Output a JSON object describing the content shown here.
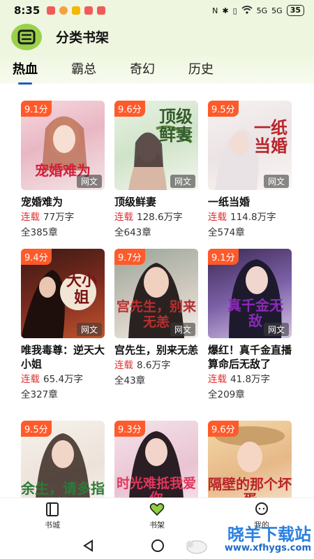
{
  "status_bar": {
    "time": "8:35",
    "signal_label": "5G",
    "battery": "35"
  },
  "header": {
    "title": "分类书架"
  },
  "tabs": [
    {
      "label": "热血",
      "active": true
    },
    {
      "label": "霸总",
      "active": false
    },
    {
      "label": "奇幻",
      "active": false
    },
    {
      "label": "历史",
      "active": false
    }
  ],
  "books": [
    {
      "title": "宠婚难为",
      "score": "9.1分",
      "status": "连载",
      "words": "77万字",
      "chapters": "全385章",
      "badge": "网文",
      "cover_text": "宠婚难为"
    },
    {
      "title": "顶级鲜妻",
      "score": "9.6分",
      "status": "连载",
      "words": "128.6万字",
      "chapters": "全643章",
      "badge": "网文",
      "cover_text": "顶级鲜妻"
    },
    {
      "title": "一纸当婚",
      "score": "9.5分",
      "status": "连载",
      "words": "114.8万字",
      "chapters": "全574章",
      "badge": "网文",
      "cover_text": "一纸当婚"
    },
    {
      "title": "唯我毒尊：逆天大小姐",
      "score": "9.4分",
      "status": "连载",
      "words": "65.4万字",
      "chapters": "全327章",
      "badge": "网文",
      "cover_text": "大小姐"
    },
    {
      "title": "宫先生，别来无恙",
      "score": "9.7分",
      "status": "连载",
      "words": "8.6万字",
      "chapters": "全43章",
      "badge": "网文",
      "cover_text": "宫先生，别来无恙"
    },
    {
      "title": "爆红！真千金直播算命后无敌了",
      "score": "9.1分",
      "status": "连载",
      "words": "41.8万字",
      "chapters": "全209章",
      "badge": "网文",
      "cover_text": "真千金无敌"
    },
    {
      "title": "",
      "score": "9.5分",
      "status": "",
      "words": "",
      "chapters": "",
      "badge": "",
      "cover_text": "余生，请多指教"
    },
    {
      "title": "",
      "score": "9.3分",
      "status": "",
      "words": "",
      "chapters": "",
      "badge": "",
      "cover_text": "时光难抵我爱你"
    },
    {
      "title": "",
      "score": "9.6分",
      "status": "",
      "words": "",
      "chapters": "",
      "badge": "",
      "cover_text": "隔壁的那个坏蛋"
    }
  ],
  "bottom_nav": [
    {
      "label": "书城",
      "icon": "book-icon",
      "active": false
    },
    {
      "label": "书架",
      "icon": "heart-icon",
      "active": true
    },
    {
      "label": "我的",
      "icon": "chat-icon",
      "active": false
    }
  ],
  "watermark": {
    "title": "晓羊下载站",
    "url": "www.xfhygs.com"
  }
}
